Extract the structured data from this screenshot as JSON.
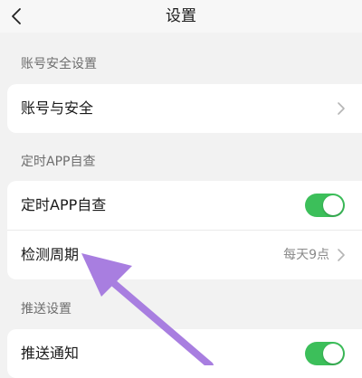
{
  "header": {
    "title": "设置"
  },
  "sections": {
    "account": {
      "label": "账号安全设置",
      "rows": {
        "account_security": {
          "label": "账号与安全"
        }
      }
    },
    "scheduled_check": {
      "label": "定时APP自查",
      "rows": {
        "scheduled_check": {
          "label": "定时APP自查",
          "enabled": true
        },
        "check_period": {
          "label": "检测周期",
          "value": "每天9点"
        }
      }
    },
    "push": {
      "label": "推送设置",
      "rows": {
        "push_notification": {
          "label": "推送通知",
          "enabled": true
        }
      }
    }
  },
  "colors": {
    "toggle_on": "#3cbf5a",
    "annotation_arrow": "#a87ee0"
  }
}
